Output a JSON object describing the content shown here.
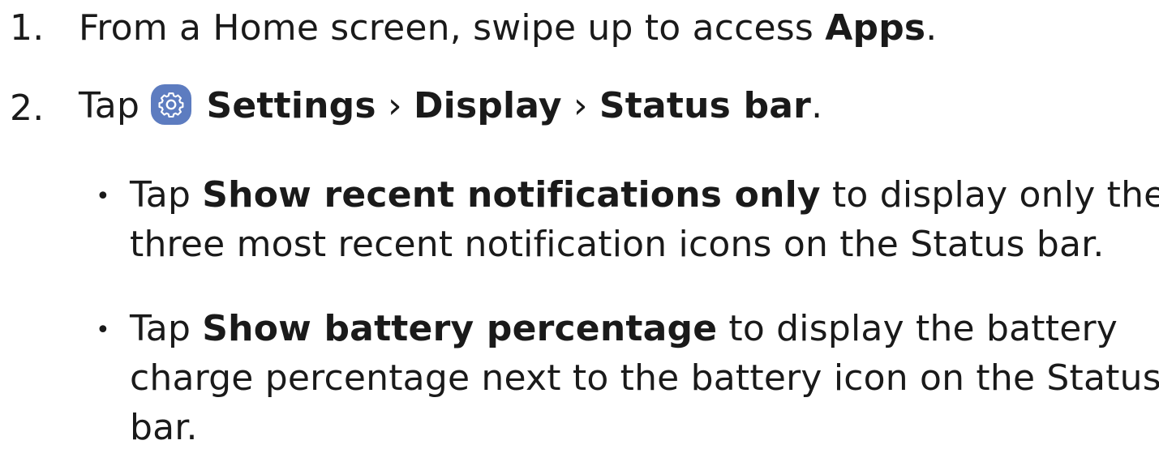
{
  "steps": [
    {
      "number": "1.",
      "text_before": "From a Home screen, swipe up to access ",
      "bold": "Apps",
      "text_after": "."
    },
    {
      "number": "2.",
      "text_before": "Tap ",
      "icon": "settings-gear-icon",
      "icon_color": "#5d7cc0",
      "path": [
        "Settings",
        "Display",
        "Status bar"
      ],
      "separator": "›",
      "text_after": "."
    }
  ],
  "bullets": [
    {
      "marker": "•",
      "prefix": "Tap ",
      "bold": "Show recent notifications only",
      "line1_rest": " to display only the",
      "line2": "three most recent notification icons on the Status bar."
    },
    {
      "marker": "•",
      "prefix": "Tap ",
      "bold": "Show battery percentage",
      "line1_rest": " to display the battery",
      "line2": "charge percentage next to the battery icon on the Status",
      "line3": "bar."
    }
  ]
}
